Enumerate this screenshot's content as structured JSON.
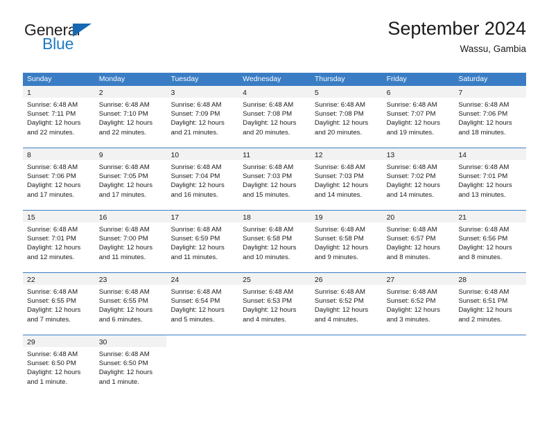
{
  "brand": {
    "name_part1": "General",
    "name_part2": "Blue",
    "triangle_icon": "triangle-icon",
    "accent_color": "#1668b3",
    "blue_text_color": "#1f7bc1"
  },
  "header": {
    "title": "September 2024",
    "subtitle": "Wassu, Gambia"
  },
  "calendar": {
    "header_bg": "#3a7dc4",
    "daynum_bg": "#f2f2f2",
    "weekdays": [
      "Sunday",
      "Monday",
      "Tuesday",
      "Wednesday",
      "Thursday",
      "Friday",
      "Saturday"
    ],
    "weeks": [
      [
        {
          "day": "1",
          "sunrise": "Sunrise: 6:48 AM",
          "sunset": "Sunset: 7:11 PM",
          "daylight_line1": "Daylight: 12 hours",
          "daylight_line2": "and 22 minutes."
        },
        {
          "day": "2",
          "sunrise": "Sunrise: 6:48 AM",
          "sunset": "Sunset: 7:10 PM",
          "daylight_line1": "Daylight: 12 hours",
          "daylight_line2": "and 22 minutes."
        },
        {
          "day": "3",
          "sunrise": "Sunrise: 6:48 AM",
          "sunset": "Sunset: 7:09 PM",
          "daylight_line1": "Daylight: 12 hours",
          "daylight_line2": "and 21 minutes."
        },
        {
          "day": "4",
          "sunrise": "Sunrise: 6:48 AM",
          "sunset": "Sunset: 7:08 PM",
          "daylight_line1": "Daylight: 12 hours",
          "daylight_line2": "and 20 minutes."
        },
        {
          "day": "5",
          "sunrise": "Sunrise: 6:48 AM",
          "sunset": "Sunset: 7:08 PM",
          "daylight_line1": "Daylight: 12 hours",
          "daylight_line2": "and 20 minutes."
        },
        {
          "day": "6",
          "sunrise": "Sunrise: 6:48 AM",
          "sunset": "Sunset: 7:07 PM",
          "daylight_line1": "Daylight: 12 hours",
          "daylight_line2": "and 19 minutes."
        },
        {
          "day": "7",
          "sunrise": "Sunrise: 6:48 AM",
          "sunset": "Sunset: 7:06 PM",
          "daylight_line1": "Daylight: 12 hours",
          "daylight_line2": "and 18 minutes."
        }
      ],
      [
        {
          "day": "8",
          "sunrise": "Sunrise: 6:48 AM",
          "sunset": "Sunset: 7:06 PM",
          "daylight_line1": "Daylight: 12 hours",
          "daylight_line2": "and 17 minutes."
        },
        {
          "day": "9",
          "sunrise": "Sunrise: 6:48 AM",
          "sunset": "Sunset: 7:05 PM",
          "daylight_line1": "Daylight: 12 hours",
          "daylight_line2": "and 17 minutes."
        },
        {
          "day": "10",
          "sunrise": "Sunrise: 6:48 AM",
          "sunset": "Sunset: 7:04 PM",
          "daylight_line1": "Daylight: 12 hours",
          "daylight_line2": "and 16 minutes."
        },
        {
          "day": "11",
          "sunrise": "Sunrise: 6:48 AM",
          "sunset": "Sunset: 7:03 PM",
          "daylight_line1": "Daylight: 12 hours",
          "daylight_line2": "and 15 minutes."
        },
        {
          "day": "12",
          "sunrise": "Sunrise: 6:48 AM",
          "sunset": "Sunset: 7:03 PM",
          "daylight_line1": "Daylight: 12 hours",
          "daylight_line2": "and 14 minutes."
        },
        {
          "day": "13",
          "sunrise": "Sunrise: 6:48 AM",
          "sunset": "Sunset: 7:02 PM",
          "daylight_line1": "Daylight: 12 hours",
          "daylight_line2": "and 14 minutes."
        },
        {
          "day": "14",
          "sunrise": "Sunrise: 6:48 AM",
          "sunset": "Sunset: 7:01 PM",
          "daylight_line1": "Daylight: 12 hours",
          "daylight_line2": "and 13 minutes."
        }
      ],
      [
        {
          "day": "15",
          "sunrise": "Sunrise: 6:48 AM",
          "sunset": "Sunset: 7:01 PM",
          "daylight_line1": "Daylight: 12 hours",
          "daylight_line2": "and 12 minutes."
        },
        {
          "day": "16",
          "sunrise": "Sunrise: 6:48 AM",
          "sunset": "Sunset: 7:00 PM",
          "daylight_line1": "Daylight: 12 hours",
          "daylight_line2": "and 11 minutes."
        },
        {
          "day": "17",
          "sunrise": "Sunrise: 6:48 AM",
          "sunset": "Sunset: 6:59 PM",
          "daylight_line1": "Daylight: 12 hours",
          "daylight_line2": "and 11 minutes."
        },
        {
          "day": "18",
          "sunrise": "Sunrise: 6:48 AM",
          "sunset": "Sunset: 6:58 PM",
          "daylight_line1": "Daylight: 12 hours",
          "daylight_line2": "and 10 minutes."
        },
        {
          "day": "19",
          "sunrise": "Sunrise: 6:48 AM",
          "sunset": "Sunset: 6:58 PM",
          "daylight_line1": "Daylight: 12 hours",
          "daylight_line2": "and 9 minutes."
        },
        {
          "day": "20",
          "sunrise": "Sunrise: 6:48 AM",
          "sunset": "Sunset: 6:57 PM",
          "daylight_line1": "Daylight: 12 hours",
          "daylight_line2": "and 8 minutes."
        },
        {
          "day": "21",
          "sunrise": "Sunrise: 6:48 AM",
          "sunset": "Sunset: 6:56 PM",
          "daylight_line1": "Daylight: 12 hours",
          "daylight_line2": "and 8 minutes."
        }
      ],
      [
        {
          "day": "22",
          "sunrise": "Sunrise: 6:48 AM",
          "sunset": "Sunset: 6:55 PM",
          "daylight_line1": "Daylight: 12 hours",
          "daylight_line2": "and 7 minutes."
        },
        {
          "day": "23",
          "sunrise": "Sunrise: 6:48 AM",
          "sunset": "Sunset: 6:55 PM",
          "daylight_line1": "Daylight: 12 hours",
          "daylight_line2": "and 6 minutes."
        },
        {
          "day": "24",
          "sunrise": "Sunrise: 6:48 AM",
          "sunset": "Sunset: 6:54 PM",
          "daylight_line1": "Daylight: 12 hours",
          "daylight_line2": "and 5 minutes."
        },
        {
          "day": "25",
          "sunrise": "Sunrise: 6:48 AM",
          "sunset": "Sunset: 6:53 PM",
          "daylight_line1": "Daylight: 12 hours",
          "daylight_line2": "and 4 minutes."
        },
        {
          "day": "26",
          "sunrise": "Sunrise: 6:48 AM",
          "sunset": "Sunset: 6:52 PM",
          "daylight_line1": "Daylight: 12 hours",
          "daylight_line2": "and 4 minutes."
        },
        {
          "day": "27",
          "sunrise": "Sunrise: 6:48 AM",
          "sunset": "Sunset: 6:52 PM",
          "daylight_line1": "Daylight: 12 hours",
          "daylight_line2": "and 3 minutes."
        },
        {
          "day": "28",
          "sunrise": "Sunrise: 6:48 AM",
          "sunset": "Sunset: 6:51 PM",
          "daylight_line1": "Daylight: 12 hours",
          "daylight_line2": "and 2 minutes."
        }
      ],
      [
        {
          "day": "29",
          "sunrise": "Sunrise: 6:48 AM",
          "sunset": "Sunset: 6:50 PM",
          "daylight_line1": "Daylight: 12 hours",
          "daylight_line2": "and 1 minute."
        },
        {
          "day": "30",
          "sunrise": "Sunrise: 6:48 AM",
          "sunset": "Sunset: 6:50 PM",
          "daylight_line1": "Daylight: 12 hours",
          "daylight_line2": "and 1 minute."
        },
        {
          "day": "",
          "sunrise": "",
          "sunset": "",
          "daylight_line1": "",
          "daylight_line2": ""
        },
        {
          "day": "",
          "sunrise": "",
          "sunset": "",
          "daylight_line1": "",
          "daylight_line2": ""
        },
        {
          "day": "",
          "sunrise": "",
          "sunset": "",
          "daylight_line1": "",
          "daylight_line2": ""
        },
        {
          "day": "",
          "sunrise": "",
          "sunset": "",
          "daylight_line1": "",
          "daylight_line2": ""
        },
        {
          "day": "",
          "sunrise": "",
          "sunset": "",
          "daylight_line1": "",
          "daylight_line2": ""
        }
      ]
    ]
  }
}
